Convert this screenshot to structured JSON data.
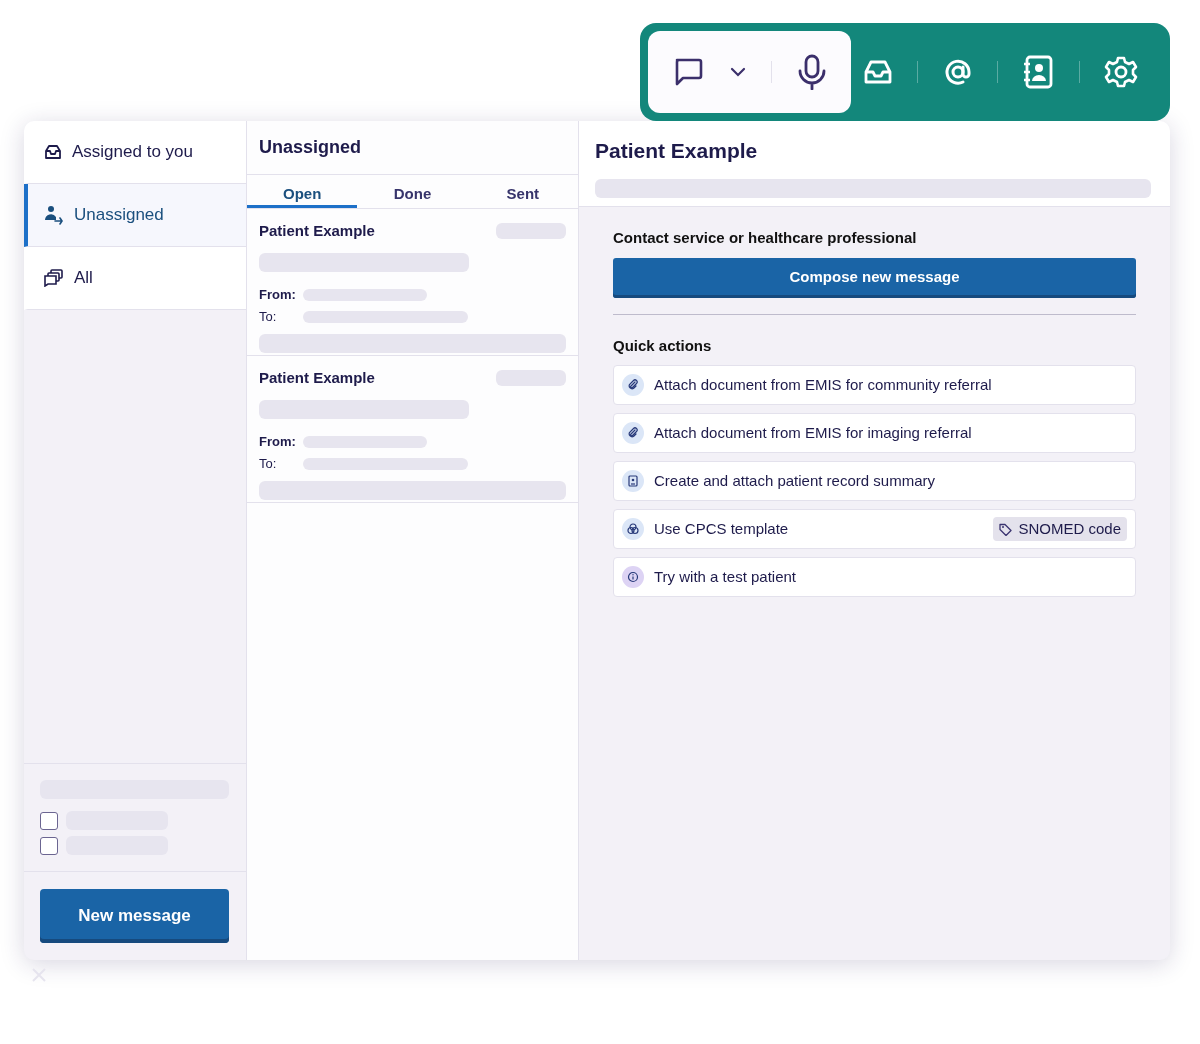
{
  "toolbar": {
    "groups": [
      {
        "kind": "compose",
        "items": [
          {
            "kind": "chat"
          },
          {
            "kind": "caret"
          },
          {
            "kind": "mic"
          }
        ]
      },
      {
        "kind": "nav",
        "items": [
          {
            "kind": "inbox"
          },
          {
            "kind": "mention"
          },
          {
            "kind": "contacts"
          },
          {
            "kind": "settings"
          }
        ]
      }
    ]
  },
  "sidebar": {
    "items": [
      {
        "kind": "assigned",
        "label": "Assigned to you",
        "selected": false
      },
      {
        "kind": "unassigned",
        "label": "Unassigned",
        "selected": true
      },
      {
        "kind": "all",
        "label": "All",
        "selected": false
      }
    ],
    "filters": [
      {
        "checked": false
      },
      {
        "checked": false
      }
    ],
    "new_button": "New message"
  },
  "list": {
    "title": "Unassigned",
    "tabs": [
      {
        "label": "Open",
        "selected": true
      },
      {
        "label": "Done",
        "selected": false
      },
      {
        "label": "Sent",
        "selected": false
      }
    ],
    "messages": [
      {
        "name": "Patient Example",
        "from_label": "From:",
        "to_label": "To:"
      },
      {
        "name": "Patient Example",
        "from_label": "From:",
        "to_label": "To:"
      }
    ]
  },
  "detail": {
    "title": "Patient Example",
    "contact_heading": "Contact service or healthcare professional",
    "compose_button": "Compose new message",
    "quick_heading": "Quick actions",
    "actions": [
      {
        "kind": "attach",
        "label": "Attach document from EMIS for community referral"
      },
      {
        "kind": "attach",
        "label": "Attach document from EMIS for imaging referral"
      },
      {
        "kind": "record",
        "label": "Create and attach patient record summary"
      },
      {
        "kind": "template",
        "label": "Use CPCS template",
        "tag": "SNOMED code"
      },
      {
        "kind": "info",
        "label": "Try with a test patient"
      }
    ]
  }
}
